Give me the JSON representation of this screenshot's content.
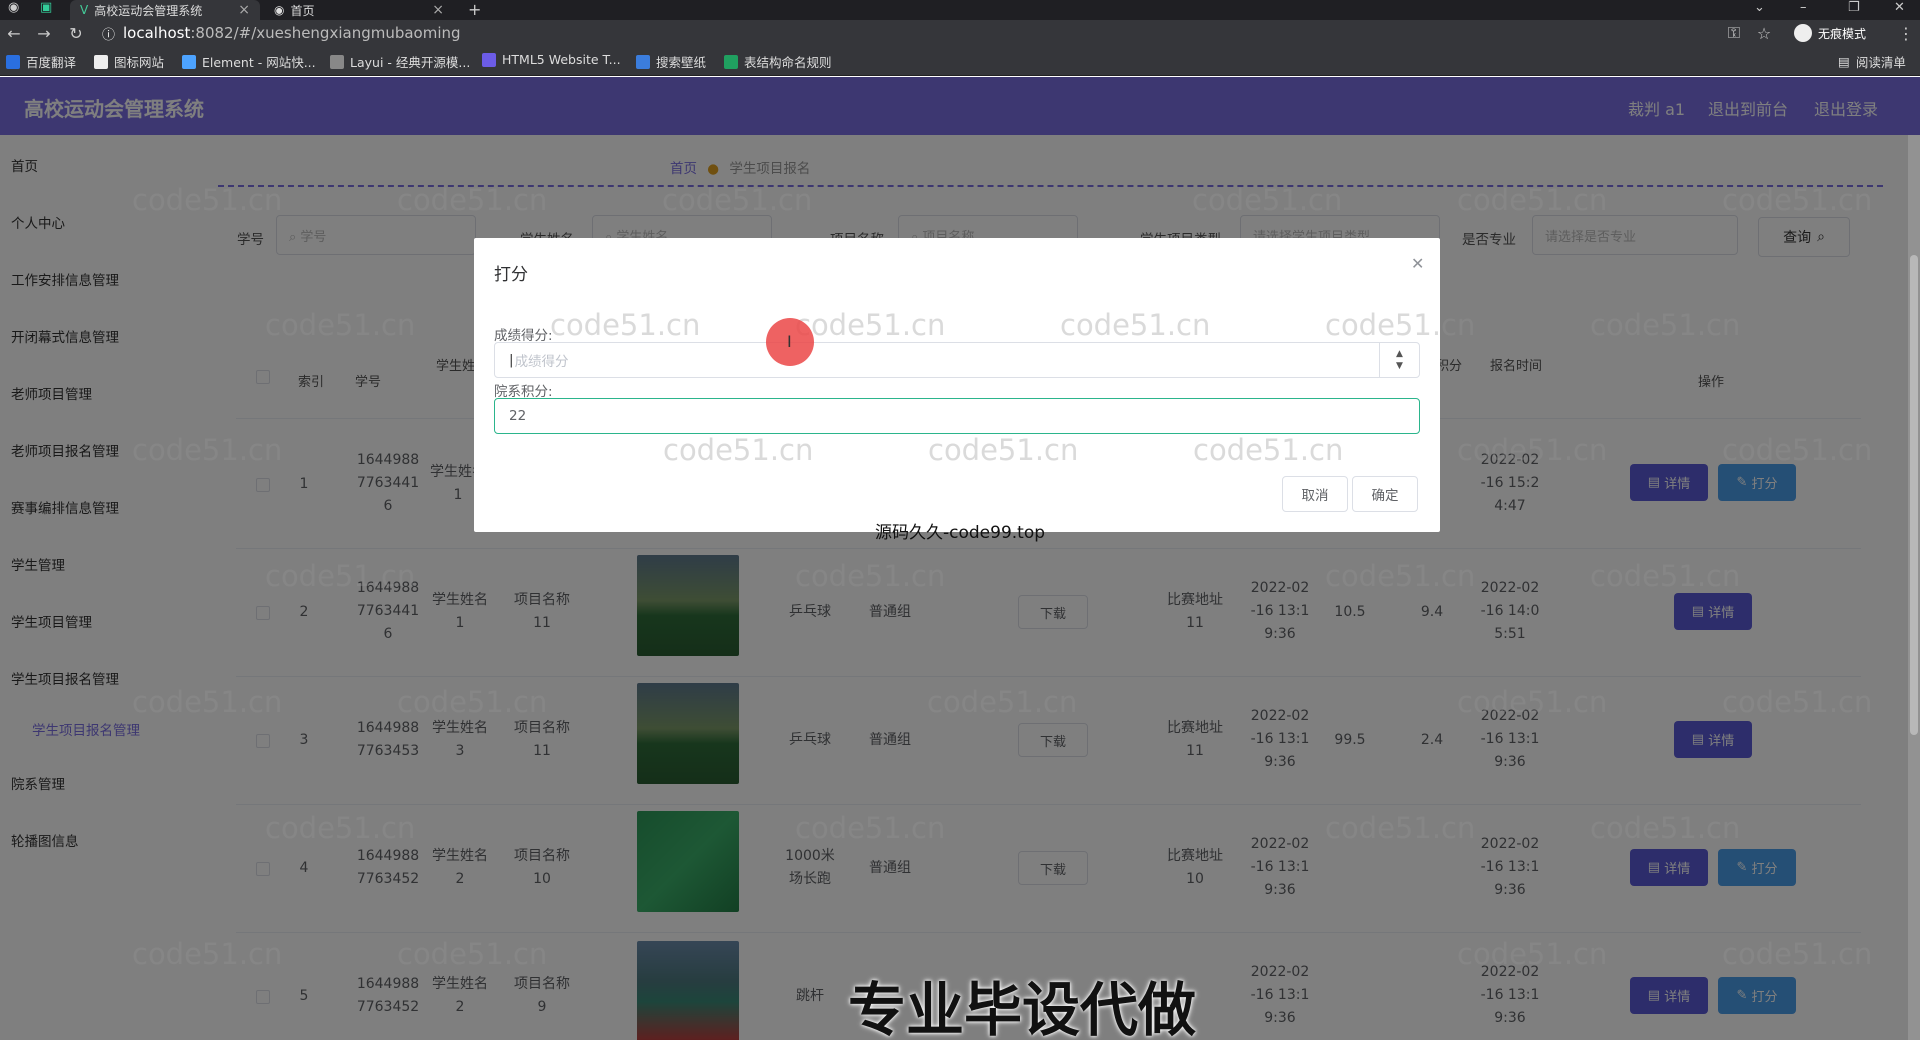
{
  "browser": {
    "tabs": [
      {
        "title": "高校运动会管理系统"
      },
      {
        "title": "首页"
      }
    ],
    "url_host": "localhost",
    "url_path": ":8082/#/xueshengxiangmubaoming",
    "incognito_label": "无痕模式",
    "bookmarks": [
      "百度翻译",
      "图标网站",
      "Element - 网站快...",
      "Layui - 经典开源模...",
      "HTML5 Website T...",
      "搜索壁纸",
      "表结构命名规则"
    ],
    "reading_list": "阅读清单"
  },
  "header": {
    "title": "高校运动会管理系统",
    "user": "裁判 a1",
    "to_front": "退出到前台",
    "logout": "退出登录"
  },
  "sidebar": {
    "items": [
      "首页",
      "个人中心",
      "工作安排信息管理",
      "开闭幕式信息管理",
      "老师项目管理",
      "老师项目报名管理",
      "赛事编排信息管理",
      "学生管理",
      "学生项目管理",
      "学生项目报名管理",
      "学生项目报名管理",
      "院系管理",
      "轮播图信息"
    ]
  },
  "breadcrumb": {
    "home": "首页",
    "current": "学生项目报名"
  },
  "filters": {
    "labels": [
      "学号",
      "学生姓名",
      "项目名称",
      "学生项目类型",
      "是否专业"
    ],
    "placeholders": [
      "学号",
      "学生姓名",
      "项目名称",
      "请选择学生项目类型",
      "请选择是否专业"
    ],
    "query": "查询"
  },
  "table": {
    "headers": [
      "索引",
      "学号",
      "学生姓名",
      "积分",
      "报名时间",
      "操作"
    ],
    "rows": [
      {
        "index": "1",
        "id": "1644988\n7763441\n6",
        "name": "学生姓名\n1",
        "project": "",
        "sport": "",
        "group": "",
        "address": "",
        "time": "",
        "score": "",
        "points": "",
        "reg": "2022-02\n-16 15:2\n4:47",
        "score_btn": true
      },
      {
        "index": "2",
        "id": "1644988\n7763441\n6",
        "name": "学生姓名\n1",
        "project": "项目名称\n11",
        "sport": "乒乓球",
        "group": "普通组",
        "address": "比赛地址\n11",
        "time": "2022-02\n-16 13:1\n9:36",
        "score": "10.5",
        "points": "9.4",
        "reg": "2022-02\n-16 14:0\n5:51",
        "score_btn": false
      },
      {
        "index": "3",
        "id": "1644988\n7763453",
        "name": "学生姓名\n3",
        "project": "项目名称\n11",
        "sport": "乒乓球",
        "group": "普通组",
        "address": "比赛地址\n11",
        "time": "2022-02\n-16 13:1\n9:36",
        "score": "99.5",
        "points": "2.4",
        "reg": "2022-02\n-16 13:1\n9:36",
        "score_btn": false
      },
      {
        "index": "4",
        "id": "1644988\n7763452",
        "name": "学生姓名\n2",
        "project": "项目名称\n10",
        "sport": "1000米\n场长跑",
        "group": "普通组",
        "address": "比赛地址\n10",
        "time": "2022-02\n-16 13:1\n9:36",
        "score": "",
        "points": "",
        "reg": "2022-02\n-16 13:1\n9:36",
        "score_btn": true
      },
      {
        "index": "5",
        "id": "1644988\n7763452",
        "name": "学生姓名\n2",
        "project": "项目名称\n9",
        "sport": "跳杆",
        "group": "",
        "address": "",
        "time": "2022-02\n-16 13:1\n9:36",
        "score": "",
        "points": "",
        "reg": "2022-02\n-16 13:1\n9:36",
        "score_btn": true
      }
    ],
    "download": "下载",
    "detail": "详情",
    "score": "打分"
  },
  "dialog": {
    "title": "打分",
    "field1_label": "成绩得分:",
    "field1_placeholder": "成绩得分",
    "field2_label": "院系积分:",
    "field2_value": "22",
    "cancel": "取消",
    "confirm": "确定"
  },
  "overlay_text": {
    "watermark": "code51.cn",
    "caption_small": "源码久久-code99.top",
    "caption_big": "专业毕设代做"
  }
}
